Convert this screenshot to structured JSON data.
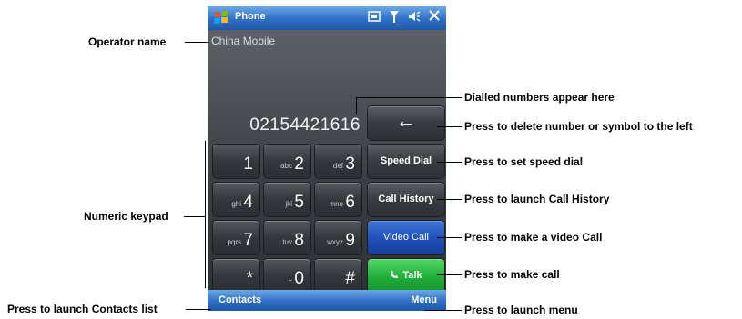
{
  "phone": {
    "title": "Phone",
    "operator": "China Mobile",
    "dialed_number": "02154421616",
    "keys": [
      {
        "num": "1",
        "sub": ""
      },
      {
        "num": "2",
        "sub": "abc"
      },
      {
        "num": "3",
        "sub": "def"
      },
      {
        "num": "4",
        "sub": "ghi"
      },
      {
        "num": "5",
        "sub": "jkl"
      },
      {
        "num": "6",
        "sub": "mno"
      },
      {
        "num": "7",
        "sub": "pqrs"
      },
      {
        "num": "8",
        "sub": "tuv"
      },
      {
        "num": "9",
        "sub": "wxyz"
      },
      {
        "num": "*",
        "sub": ""
      },
      {
        "num": "0",
        "sub": "+"
      },
      {
        "num": "#",
        "sub": ""
      }
    ],
    "backspace_label": "←",
    "speed_dial_label": "Speed Dial",
    "call_history_label": "Call History",
    "video_call_label": "Video Call",
    "talk_label": "Talk",
    "contacts_label": "Contacts",
    "menu_label": "Menu"
  },
  "callouts": {
    "operator_name": "Operator name",
    "numeric_keypad": "Numeric keypad",
    "contacts_list": "Press to launch Contacts list",
    "dialled_numbers": "Dialled numbers appear here",
    "delete": "Press to delete number or symbol to the left",
    "speed_dial": "Press to set speed dial",
    "call_history": "Press to launch Call History",
    "video_call": "Press to make a video Call",
    "make_call": "Press to make call",
    "launch_menu": "Press to launch menu"
  }
}
